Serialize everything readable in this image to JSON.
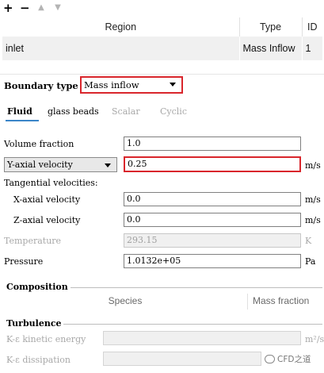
{
  "toolbar": {
    "add": "+",
    "remove": "−",
    "up": "▲",
    "down": "▼"
  },
  "region_table": {
    "headers": [
      "Region",
      "Type",
      "ID"
    ],
    "rows": [
      [
        "inlet",
        "Mass Inflow",
        "1"
      ]
    ]
  },
  "boundary_type": {
    "label": "Boundary type",
    "value": "Mass inflow"
  },
  "tabs": [
    "Fluid",
    "glass beads",
    "Scalar",
    "Cyclic"
  ],
  "fluid": {
    "volume_fraction": {
      "label": "Volume fraction",
      "value": "1.0"
    },
    "axial_velocity": {
      "selector": "Y-axial velocity",
      "value": "0.25",
      "unit": "m/s"
    },
    "tangential_label": "Tangential velocities:",
    "x_axial": {
      "label": "X-axial velocity",
      "value": "0.0",
      "unit": "m/s"
    },
    "z_axial": {
      "label": "Z-axial velocity",
      "value": "0.0",
      "unit": "m/s"
    },
    "temperature": {
      "label": "Temperature",
      "value": "293.15",
      "unit": "K"
    },
    "pressure": {
      "label": "Pressure",
      "value": "1.0132e+05",
      "unit": "Pa"
    }
  },
  "composition": {
    "title": "Composition",
    "columns": [
      "Species",
      "Mass fraction"
    ]
  },
  "turbulence": {
    "title": "Turbulence",
    "k_label": "K-ε kinetic energy",
    "k_unit": "m²/s²",
    "e_label": "K-ε dissipation"
  },
  "watermark": "CFD之道",
  "colors": {
    "highlight": "#d9262c",
    "tab_accent": "#3b86c8"
  }
}
